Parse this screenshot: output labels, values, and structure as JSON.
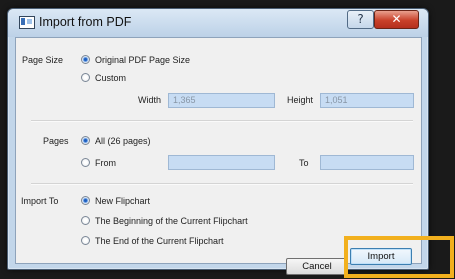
{
  "window": {
    "title": "Import from PDF",
    "help_glyph": "?",
    "close_glyph": "✕"
  },
  "page_size": {
    "label": "Page Size",
    "options": [
      {
        "label": "Original PDF Page Size",
        "selected": true
      },
      {
        "label": "Custom",
        "selected": false
      }
    ],
    "width_label": "Width",
    "width_value": "1,365",
    "height_label": "Height",
    "height_value": "1,051"
  },
  "pages": {
    "label": "Pages",
    "options": [
      {
        "label": "All (26 pages)",
        "selected": true
      },
      {
        "label": "From",
        "selected": false
      }
    ],
    "from_value": "",
    "to_label": "To",
    "to_value": ""
  },
  "import_to": {
    "label": "Import To",
    "options": [
      {
        "label": "New Flipchart",
        "selected": true
      },
      {
        "label": "The Beginning of the Current Flipchart",
        "selected": false
      },
      {
        "label": "The End of the Current Flipchart",
        "selected": false
      }
    ]
  },
  "buttons": {
    "cancel": "Cancel",
    "import": "Import"
  },
  "colors": {
    "highlight": "#f2b01e",
    "field_bg": "#c7dcf3",
    "frame": "#c2d6ea",
    "close": "#c9412a"
  },
  "icons": {
    "app": "import-window-icon",
    "help": "help-icon",
    "close": "close-icon"
  }
}
